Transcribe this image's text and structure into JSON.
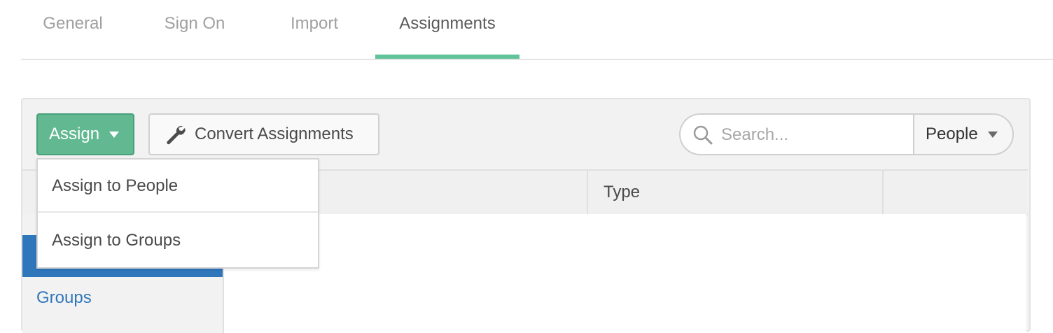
{
  "tabs": [
    {
      "label": "General",
      "active": false
    },
    {
      "label": "Sign On",
      "active": false
    },
    {
      "label": "Import",
      "active": false
    },
    {
      "label": "Assignments",
      "active": true
    }
  ],
  "toolbar": {
    "assign_label": "Assign",
    "convert_label": "Convert Assignments",
    "convert_icon": "wrench-icon"
  },
  "search": {
    "placeholder": "Search...",
    "icon": "search-icon",
    "filter_selected": "People"
  },
  "table": {
    "columns": [
      "",
      "Type",
      ""
    ]
  },
  "sidebar": {
    "items": [
      {
        "label": "",
        "selected": true
      },
      {
        "label": "Groups",
        "selected": false
      }
    ]
  },
  "assign_menu": {
    "items": [
      "Assign to People",
      "Assign to Groups"
    ]
  },
  "colors": {
    "accent_green": "#61b891",
    "tab_underline": "#61c39a",
    "selected_blue": "#2f76bb"
  }
}
